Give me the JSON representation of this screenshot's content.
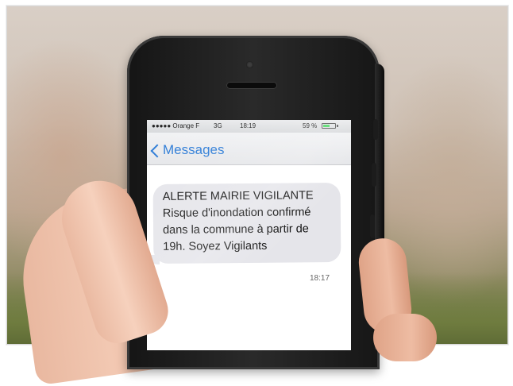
{
  "status_bar": {
    "carrier": "●●●●● Orange F",
    "network": "3G",
    "time": "18:19",
    "battery_percent": "59 %",
    "battery_level": 0.59
  },
  "nav": {
    "back_label": "Messages"
  },
  "message": {
    "lines": [
      "ALERTE MAIRIE VIGILANTE",
      "Risque d'inondation confirmé",
      "dans la commune à partir de",
      "19h. Soyez Vigilants"
    ],
    "timestamp": "18:17"
  },
  "colors": {
    "ios_blue": "#2a7ad6",
    "bubble_gray": "#e5e5ea",
    "battery_green": "#4cd964"
  },
  "icons": [
    "chevron-left-icon",
    "battery-icon"
  ]
}
